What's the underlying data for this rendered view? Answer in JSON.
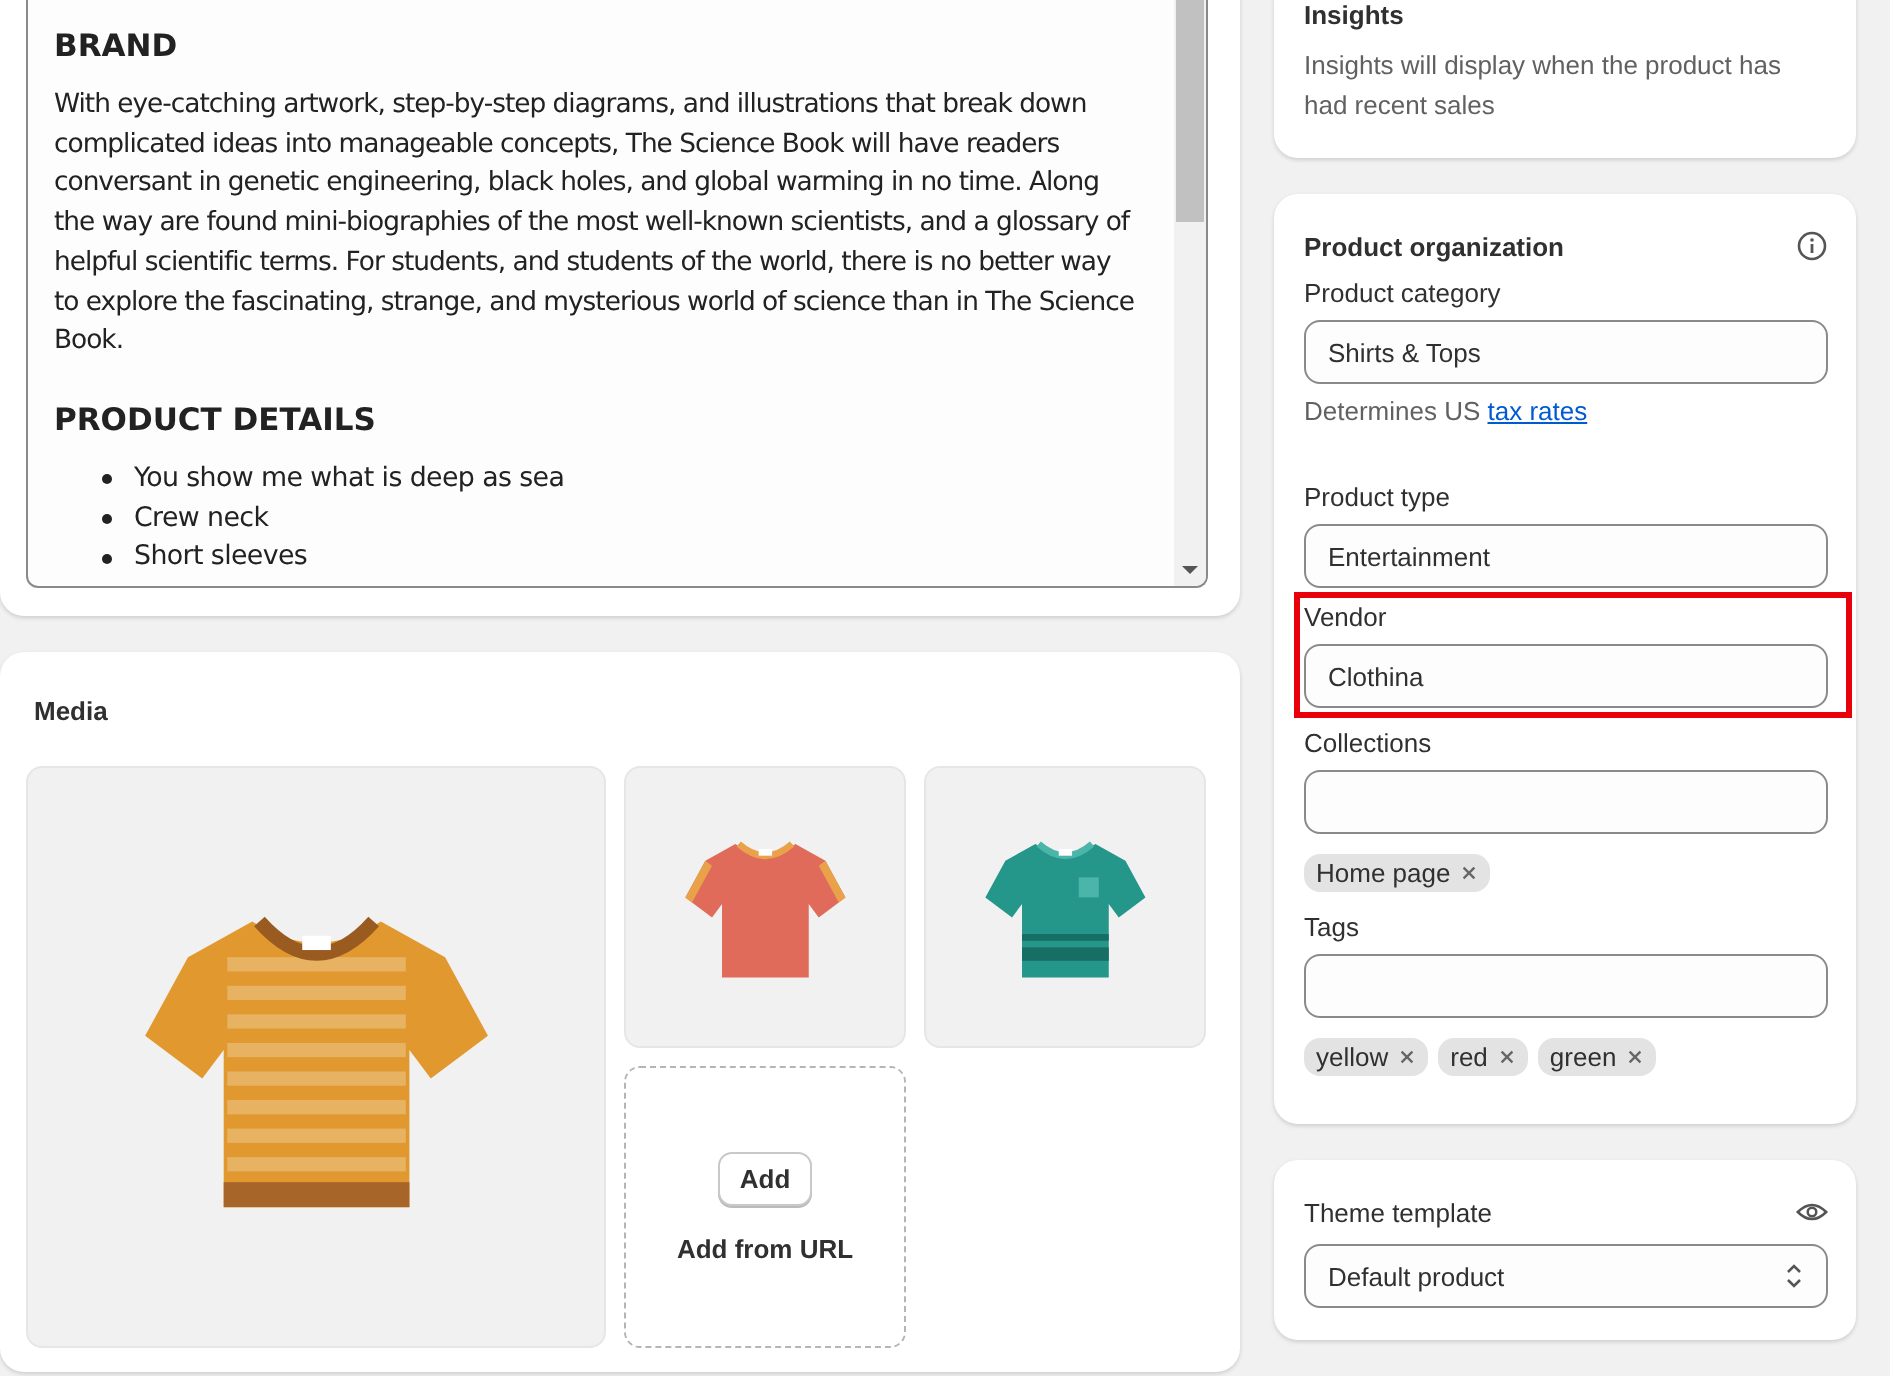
{
  "description_editor": {
    "blocks": [
      {
        "kind": "heading",
        "text": "BRAND"
      },
      {
        "kind": "paragraph",
        "text": "With eye-catching artwork, step-by-step diagrams, and illustrations that break down complicated ideas into manageable concepts, The Science Book will have readers conversant in genetic engineering, black holes, and global warming in no time. Along the way are found mini-biographies of the most well-known scientists, and a glossary of helpful scientific terms. For students, and students of the world, there is no better way to explore the fascinating, strange, and mysterious world of science than in The Science Book."
      },
      {
        "kind": "heading",
        "text": "PRODUCT DETAILS"
      },
      {
        "kind": "list",
        "items": [
          "You show me what is deep as sea",
          "Crew neck",
          "Short sleeves"
        ]
      }
    ]
  },
  "media": {
    "title": "Media",
    "images": [
      {
        "kind": "striped",
        "color": "#e0982f"
      },
      {
        "kind": "plain",
        "color": "#e06b5b"
      },
      {
        "kind": "pocket",
        "color": "#24968a"
      }
    ],
    "add_button": "Add",
    "add_from_url": "Add from URL"
  },
  "insights": {
    "title": "Insights",
    "text": "Insights will display when the product has had recent sales"
  },
  "product_organization": {
    "title": "Product organization",
    "fields": [
      {
        "kind": "text",
        "label": "Product category",
        "value": "Shirts & Tops",
        "help": "Determines US ",
        "help_link": "tax rates",
        "highlighted": false
      },
      {
        "kind": "text",
        "label": "Product type",
        "value": "Entertainment",
        "highlighted": false
      },
      {
        "kind": "text",
        "label": "Vendor",
        "value": "Clothina",
        "highlighted": true
      },
      {
        "kind": "tags",
        "label": "Collections",
        "tags": [
          "Home page"
        ],
        "highlighted": false
      },
      {
        "kind": "tags",
        "label": "Tags",
        "tags": [
          "yellow",
          "red",
          "green"
        ],
        "highlighted": false
      }
    ]
  },
  "theme_template": {
    "label": "Theme template",
    "value": "Default product"
  }
}
